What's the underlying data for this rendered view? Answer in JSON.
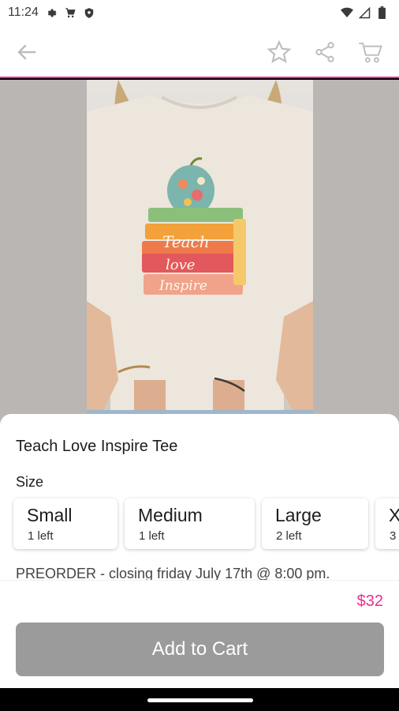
{
  "status_bar": {
    "time": "11:24",
    "icons_left": [
      "gear-icon",
      "cart-notification-icon",
      "shield-icon"
    ],
    "icons_right": [
      "wifi-icon",
      "signal-icon",
      "battery-icon"
    ]
  },
  "app_bar": {
    "icons": [
      "back-arrow-icon",
      "star-icon",
      "share-icon",
      "cart-icon"
    ]
  },
  "colors": {
    "accent": "#e8308a",
    "button_disabled": "#9b9b9b",
    "text": "#1d1d1d"
  },
  "product": {
    "title": "Teach Love Inspire Tee",
    "size_label": "Size",
    "sizes": [
      {
        "name": "Small",
        "stock": "1 left"
      },
      {
        "name": "Medium",
        "stock": "1 left"
      },
      {
        "name": "Large",
        "stock": "2 left"
      },
      {
        "name": "X",
        "stock": "3"
      }
    ],
    "note": "PREORDER - closing friday July 17th @ 8:00 pm.",
    "price": "$32"
  },
  "shirt_print": {
    "line1": "Teach",
    "line2": "love",
    "line3": "Inspire"
  },
  "actions": {
    "add_to_cart": "Add to Cart"
  }
}
